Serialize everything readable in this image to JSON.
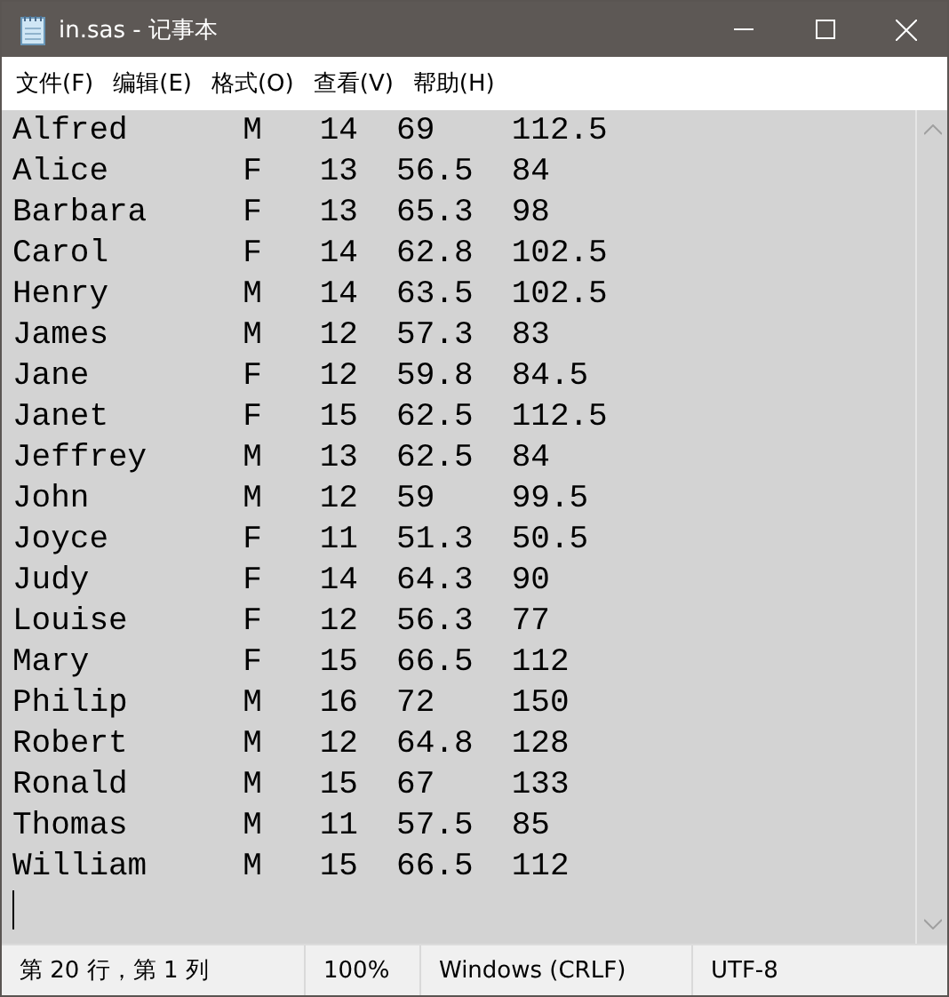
{
  "window": {
    "title": "in.sas - 记事本"
  },
  "menu": [
    "文件(F)",
    "编辑(E)",
    "格式(O)",
    "查看(V)",
    "帮助(H)"
  ],
  "editor": {
    "lines": [
      "Alfred      M   14  69    112.5",
      "Alice       F   13  56.5  84",
      "Barbara     F   13  65.3  98",
      "Carol       F   14  62.8  102.5",
      "Henry       M   14  63.5  102.5",
      "James       M   12  57.3  83",
      "Jane        F   12  59.8  84.5",
      "Janet       F   15  62.5  112.5",
      "Jeffrey     M   13  62.5  84",
      "John        M   12  59    99.5",
      "Joyce       F   11  51.3  50.5",
      "Judy        F   14  64.3  90",
      "Louise      F   12  56.3  77",
      "Mary        F   15  66.5  112",
      "Philip      M   16  72    150",
      "Robert      M   12  64.8  128",
      "Ronald      M   15  67    133",
      "Thomas      M   11  57.5  85",
      "William     M   15  66.5  112"
    ]
  },
  "status_bar": {
    "position": "第 20 行，第 1 列",
    "zoom": "100%",
    "line_ending": "Windows (CRLF)",
    "encoding": "UTF-8"
  }
}
